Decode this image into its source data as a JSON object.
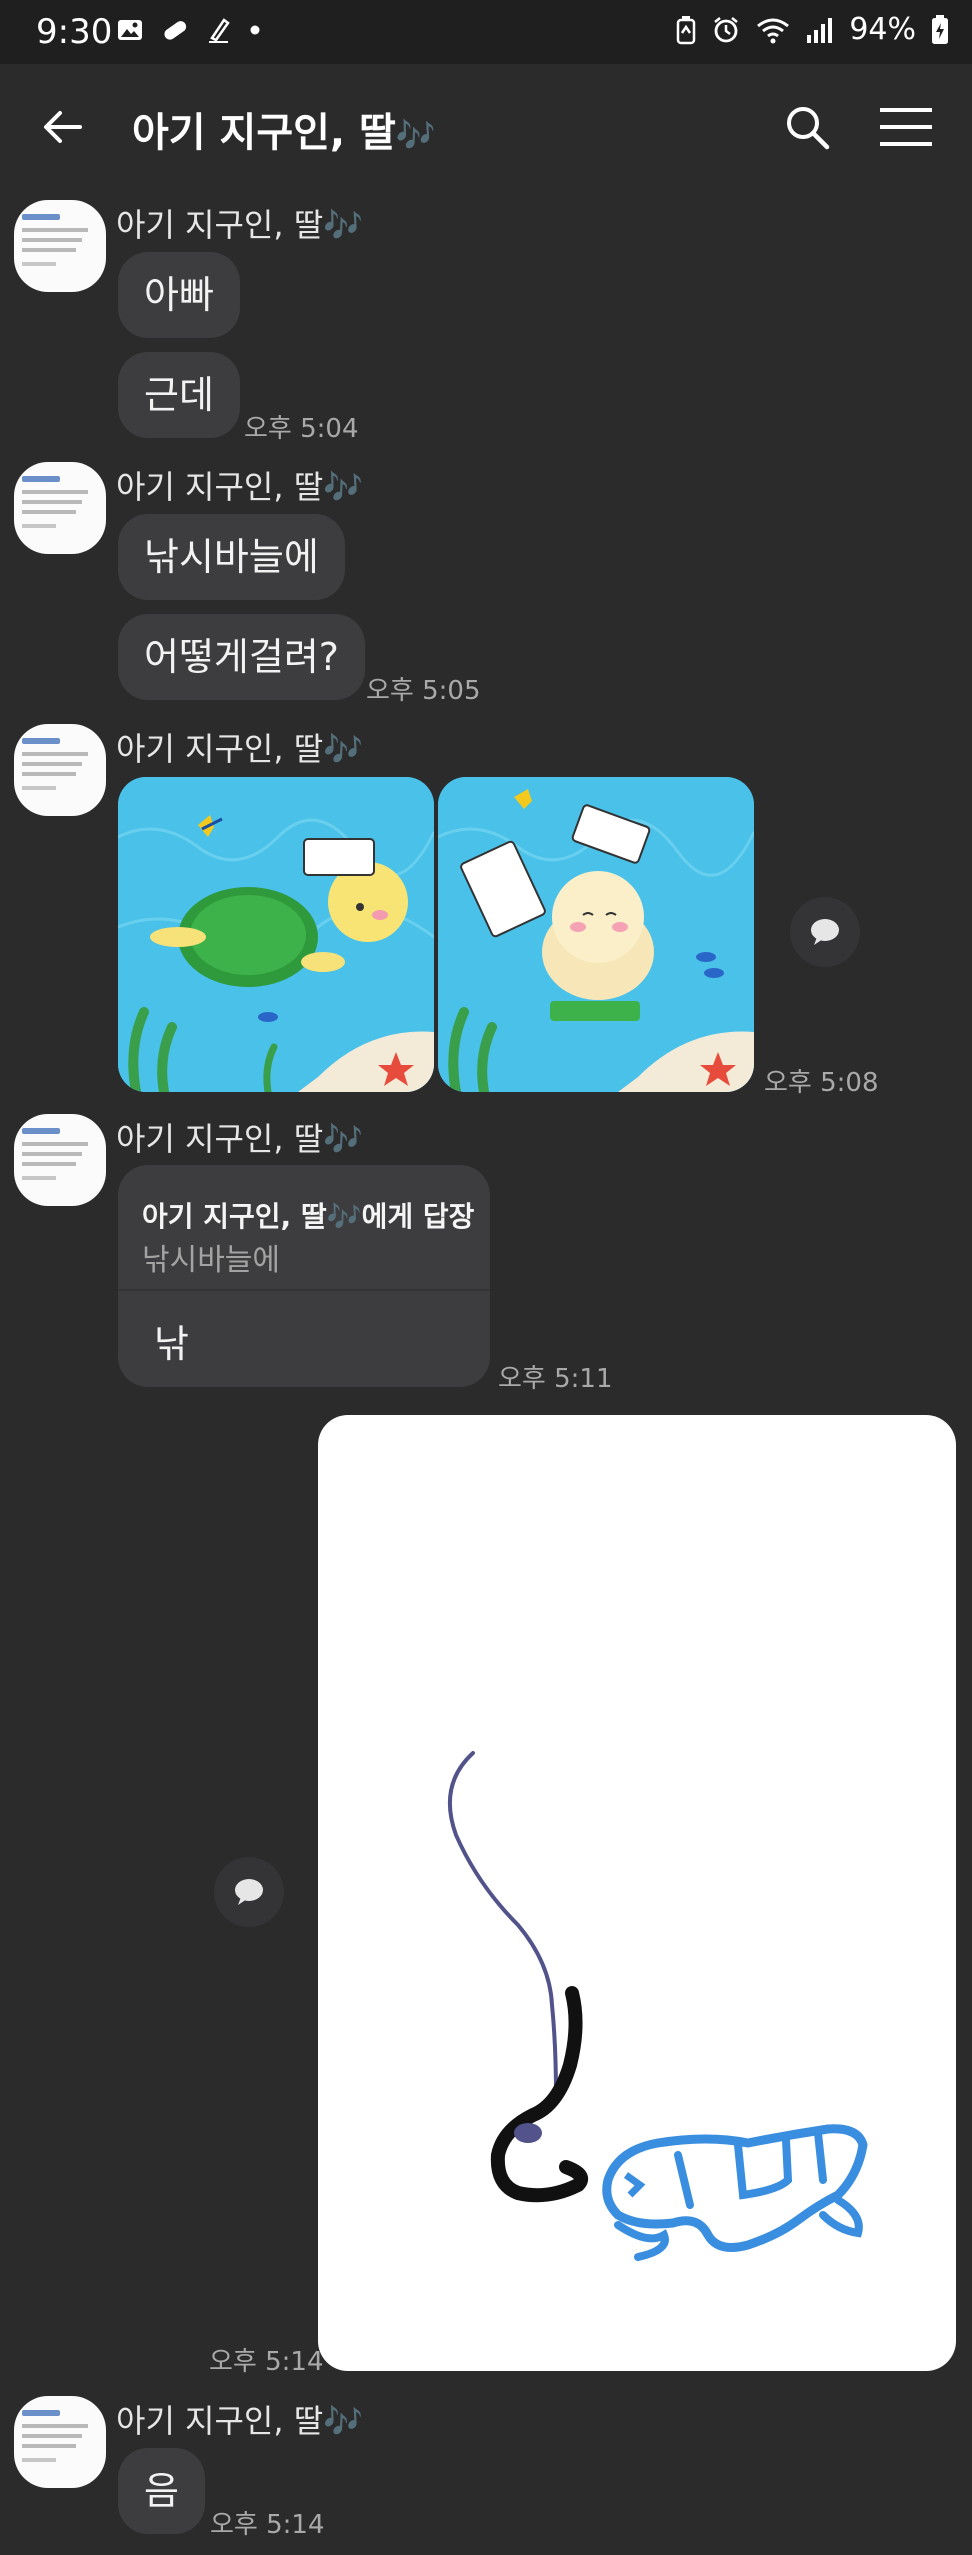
{
  "status_bar": {
    "time": "9:30",
    "battery": "94%",
    "left_icons": [
      "image-icon",
      "pill-icon",
      "pen-icon",
      "dot-icon"
    ],
    "right_icons": [
      "battery-saver-icon",
      "alarm-icon",
      "wifi-icon",
      "signal-icon",
      "battery-icon"
    ]
  },
  "header": {
    "title": "아기 지구인, 딸",
    "title_emoji": "🎶",
    "back_icon": "arrow-left-icon",
    "search_icon": "search-icon",
    "menu_icon": "hamburger-menu-icon"
  },
  "sender": {
    "name": "아기 지구인, 딸",
    "emoji": "🎶"
  },
  "messages": {
    "m1": {
      "bubbles": [
        "아빠",
        "근데"
      ],
      "time": "오후 5:04"
    },
    "m2": {
      "bubbles": [
        "낚시바늘에",
        "어떻게걸려?"
      ],
      "time": "오후 5:05"
    },
    "m3": {
      "images": [
        "turtle-illustration",
        "baby-turtle-illustration"
      ],
      "time": "오후 5:08"
    },
    "m4": {
      "reply_to": "아기 지구인, 딸",
      "reply_emoji": "🎶",
      "reply_suffix": "에게 답장",
      "quoted": "낚시바늘에",
      "text": "낚",
      "time": "오후 5:11"
    },
    "m5": {
      "drawing": "fishing-hook-fish-drawing",
      "time": "오후 5:14"
    },
    "m6": {
      "bubbles": [
        "음"
      ],
      "time": "오후 5:14"
    }
  },
  "colors": {
    "background": "#2b2b2c",
    "bubble": "#3d3d3f",
    "accent": "#9b5de0"
  }
}
